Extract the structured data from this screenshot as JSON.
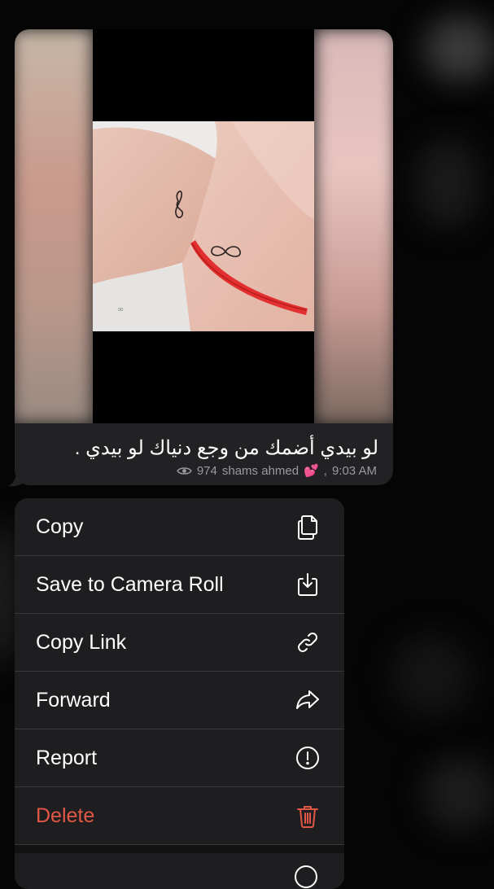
{
  "message": {
    "caption": "لو بيدي أضمك من وجع دنياك لو بيدي .",
    "views": "974",
    "author": "shams ahmed",
    "author_emoji": "💕",
    "separator": ",",
    "time": "9:03 AM"
  },
  "menu": {
    "items": [
      {
        "label": "Copy",
        "icon": "copy-icon"
      },
      {
        "label": "Save to Camera Roll",
        "icon": "download-icon"
      },
      {
        "label": "Copy Link",
        "icon": "link-icon"
      },
      {
        "label": "Forward",
        "icon": "forward-icon"
      },
      {
        "label": "Report",
        "icon": "report-icon"
      },
      {
        "label": "Delete",
        "icon": "trash-icon"
      }
    ]
  },
  "colors": {
    "background": "#050505",
    "bubble": "#222224",
    "menu": "#1e1e20",
    "danger": "#e25745",
    "meta": "#9a9a9e"
  }
}
